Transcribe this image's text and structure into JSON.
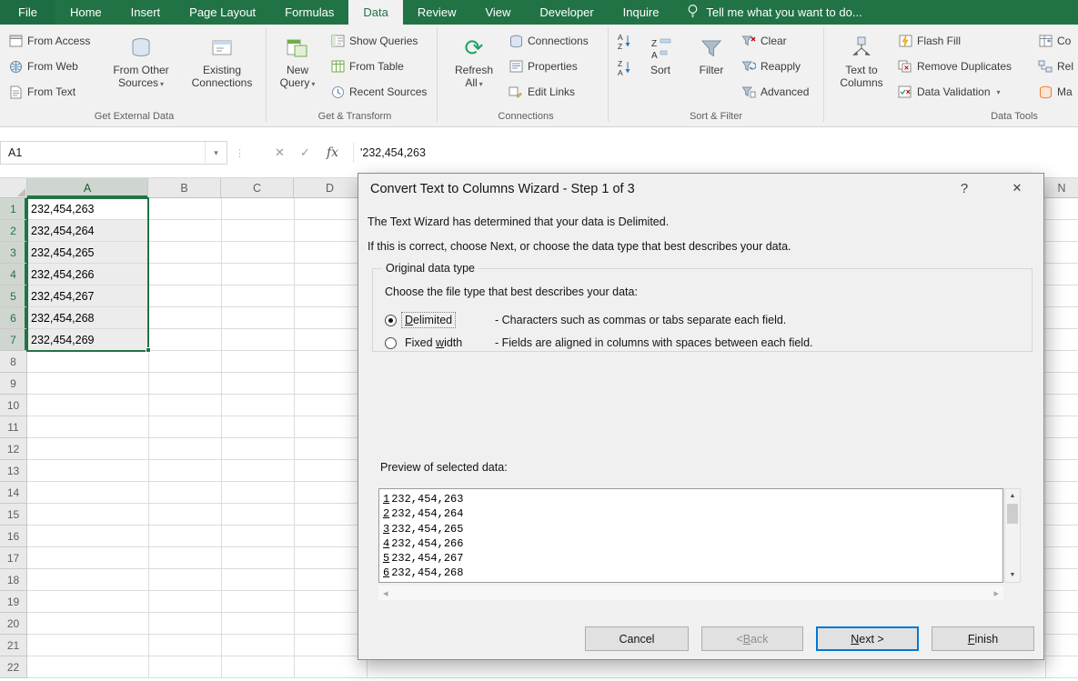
{
  "colors": {
    "excel_green": "#217346",
    "default_button_accent": "#0078d7",
    "selection_fill": "#ececec"
  },
  "tabbar": {
    "tabs": [
      {
        "label": "File",
        "file": true
      },
      {
        "label": "Home"
      },
      {
        "label": "Insert"
      },
      {
        "label": "Page Layout"
      },
      {
        "label": "Formulas"
      },
      {
        "label": "Data",
        "active": true
      },
      {
        "label": "Review"
      },
      {
        "label": "View"
      },
      {
        "label": "Developer"
      },
      {
        "label": "Inquire"
      }
    ],
    "tell_me": "Tell me what you want to do..."
  },
  "ribbon": {
    "get_external_data": {
      "label": "Get External Data",
      "from_access": "From Access",
      "from_web": "From Web",
      "from_text": "From Text",
      "from_other_sources": "From Other Sources",
      "existing_connections": "Existing Connections"
    },
    "get_transform": {
      "label": "Get & Transform",
      "new_query": "New Query",
      "show_queries": "Show Queries",
      "from_table": "From Table",
      "recent_sources": "Recent Sources"
    },
    "connections": {
      "label": "Connections",
      "refresh_all": "Refresh All",
      "connections": "Connections",
      "properties": "Properties",
      "edit_links": "Edit Links"
    },
    "sort_filter": {
      "label": "Sort & Filter",
      "sort": "Sort",
      "filter": "Filter",
      "clear": "Clear",
      "reapply": "Reapply",
      "advanced": "Advanced"
    },
    "data_tools": {
      "label": "Data Tools",
      "text_to_columns": "Text to Columns",
      "flash_fill": "Flash Fill",
      "remove_duplicates": "Remove Duplicates",
      "data_validation": "Data Validation",
      "consolidate_partial": "Co",
      "relationships_partial": "Rel",
      "manage_partial": "Ma"
    }
  },
  "formula_bar": {
    "name_box": "A1",
    "formula": "'232,454,263"
  },
  "grid": {
    "columns": [
      {
        "letter": "A",
        "selected": true
      },
      {
        "letter": "B"
      },
      {
        "letter": "C"
      },
      {
        "letter": "D"
      }
    ],
    "far_column": "N",
    "row_count": 22,
    "selected_row_count": 7,
    "values": [
      "232,454,263",
      "232,454,264",
      "232,454,265",
      "232,454,266",
      "232,454,267",
      "232,454,268",
      "232,454,269"
    ]
  },
  "dialog": {
    "title": "Convert Text to Columns Wizard - Step 1 of 3",
    "intro1": "The Text Wizard has determined that your data is Delimited.",
    "intro2": "If this is correct, choose Next, or choose the data type that best describes your data.",
    "group_label": "Original data type",
    "choose_prompt": "Choose the file type that best describes your data:",
    "delimited": {
      "pre": "",
      "key": "D",
      "post": "elimited",
      "desc": "- Characters such as commas or tabs separate each field.",
      "selected": true
    },
    "fixed_width": {
      "pre": "Fixed ",
      "key": "w",
      "post": "idth",
      "desc": "- Fields are aligned in columns with spaces between each field.",
      "selected": false
    },
    "preview_label": "Preview of selected data:",
    "preview_lines": [
      {
        "num": "1",
        "text": "232,454,263"
      },
      {
        "num": "2",
        "text": "232,454,264"
      },
      {
        "num": "3",
        "text": "232,454,265"
      },
      {
        "num": "4",
        "text": "232,454,266"
      },
      {
        "num": "5",
        "text": "232,454,267"
      },
      {
        "num": "6",
        "text": "232,454,268"
      }
    ],
    "buttons": {
      "cancel": "Cancel",
      "back_pre": "< ",
      "back_key": "B",
      "back_post": "ack",
      "next_pre": "",
      "next_key": "N",
      "next_post": "ext >",
      "finish_pre": "",
      "finish_key": "F",
      "finish_post": "inish"
    }
  },
  "glyphs": {
    "caret_down": "▾",
    "fx": "fx",
    "cancel_x": "✕",
    "enter_check": "✓",
    "splitter_dots": "⋮",
    "help": "?",
    "close": "✕",
    "scroll_up": "▲",
    "scroll_down": "▼",
    "scroll_left": "◂",
    "scroll_right": "▸",
    "refresh": "⟳"
  }
}
